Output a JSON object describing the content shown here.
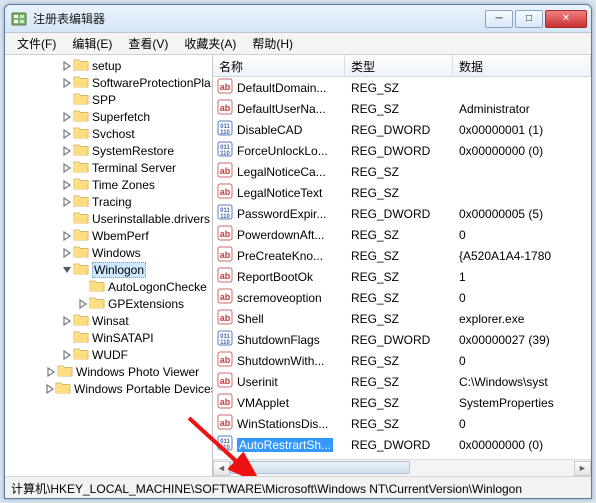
{
  "window": {
    "title": "注册表编辑器"
  },
  "menu": [
    "文件(F)",
    "编辑(E)",
    "查看(V)",
    "收藏夹(A)",
    "帮助(H)"
  ],
  "tree": {
    "items": [
      {
        "d": 3,
        "t": true,
        "l": "setup"
      },
      {
        "d": 3,
        "t": true,
        "l": "SoftwareProtectionPla"
      },
      {
        "d": 3,
        "t": false,
        "l": "SPP"
      },
      {
        "d": 3,
        "t": true,
        "l": "Superfetch"
      },
      {
        "d": 3,
        "t": true,
        "l": "Svchost"
      },
      {
        "d": 3,
        "t": true,
        "l": "SystemRestore"
      },
      {
        "d": 3,
        "t": true,
        "l": "Terminal Server"
      },
      {
        "d": 3,
        "t": true,
        "l": "Time Zones"
      },
      {
        "d": 3,
        "t": true,
        "l": "Tracing"
      },
      {
        "d": 3,
        "t": false,
        "l": "Userinstallable.drivers"
      },
      {
        "d": 3,
        "t": true,
        "l": "WbemPerf"
      },
      {
        "d": 3,
        "t": true,
        "l": "Windows"
      },
      {
        "d": 3,
        "t": true,
        "exp": true,
        "sel": true,
        "l": "Winlogon"
      },
      {
        "d": 4,
        "t": false,
        "l": "AutoLogonChecke"
      },
      {
        "d": 4,
        "t": true,
        "l": "GPExtensions"
      },
      {
        "d": 3,
        "t": true,
        "l": "Winsat"
      },
      {
        "d": 3,
        "t": false,
        "l": "WinSATAPI"
      },
      {
        "d": 3,
        "t": true,
        "l": "WUDF"
      },
      {
        "d": 2,
        "t": true,
        "l": "Windows Photo Viewer"
      },
      {
        "d": 2,
        "t": true,
        "l": "Windows Portable Devices"
      }
    ]
  },
  "list": {
    "headers": {
      "name": "名称",
      "type": "类型",
      "data": "数据"
    },
    "rows": [
      {
        "k": "sz",
        "n": "DefaultDomain...",
        "t": "REG_SZ",
        "d": ""
      },
      {
        "k": "sz",
        "n": "DefaultUserNa...",
        "t": "REG_SZ",
        "d": "Administrator"
      },
      {
        "k": "dw",
        "n": "DisableCAD",
        "t": "REG_DWORD",
        "d": "0x00000001 (1)"
      },
      {
        "k": "dw",
        "n": "ForceUnlockLo...",
        "t": "REG_DWORD",
        "d": "0x00000000 (0)"
      },
      {
        "k": "sz",
        "n": "LegalNoticeCa...",
        "t": "REG_SZ",
        "d": ""
      },
      {
        "k": "sz",
        "n": "LegalNoticeText",
        "t": "REG_SZ",
        "d": ""
      },
      {
        "k": "dw",
        "n": "PasswordExpir...",
        "t": "REG_DWORD",
        "d": "0x00000005 (5)"
      },
      {
        "k": "sz",
        "n": "PowerdownAft...",
        "t": "REG_SZ",
        "d": "0"
      },
      {
        "k": "sz",
        "n": "PreCreateKno...",
        "t": "REG_SZ",
        "d": "{A520A1A4-1780"
      },
      {
        "k": "sz",
        "n": "ReportBootOk",
        "t": "REG_SZ",
        "d": "1"
      },
      {
        "k": "sz",
        "n": "scremoveoption",
        "t": "REG_SZ",
        "d": "0"
      },
      {
        "k": "sz",
        "n": "Shell",
        "t": "REG_SZ",
        "d": "explorer.exe"
      },
      {
        "k": "dw",
        "n": "ShutdownFlags",
        "t": "REG_DWORD",
        "d": "0x00000027 (39)"
      },
      {
        "k": "sz",
        "n": "ShutdownWith...",
        "t": "REG_SZ",
        "d": "0"
      },
      {
        "k": "sz",
        "n": "Userinit",
        "t": "REG_SZ",
        "d": "C:\\Windows\\syst"
      },
      {
        "k": "sz",
        "n": "VMApplet",
        "t": "REG_SZ",
        "d": "SystemProperties"
      },
      {
        "k": "sz",
        "n": "WinStationsDis...",
        "t": "REG_SZ",
        "d": "0"
      },
      {
        "k": "dw",
        "n": "AutoRestrartSh...",
        "t": "REG_DWORD",
        "d": "0x00000000 (0)",
        "sel": true
      }
    ]
  },
  "status": "计算机\\HKEY_LOCAL_MACHINE\\SOFTWARE\\Microsoft\\Windows NT\\CurrentVersion\\Winlogon"
}
